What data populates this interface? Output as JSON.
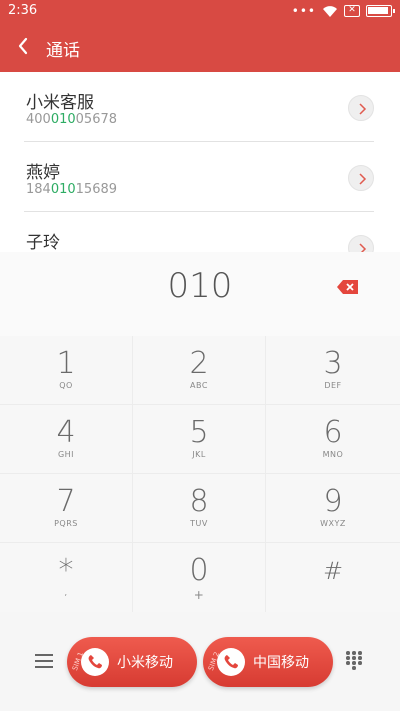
{
  "status_bar": {
    "time": "2:36",
    "dots": "•••"
  },
  "header": {
    "title": "通话"
  },
  "contacts": [
    {
      "name": "小米客服",
      "number_pre": "400",
      "number_hl": "010",
      "number_post": "05678"
    },
    {
      "name": "燕婷",
      "number_pre": "184",
      "number_hl": "010",
      "number_post": "15689"
    },
    {
      "name": "子玲",
      "number_pre": "",
      "number_hl": "",
      "number_post": ""
    }
  ],
  "dialer": {
    "input_value": "010",
    "keys": [
      {
        "digit": "1",
        "letters": "QO"
      },
      {
        "digit": "2",
        "letters": "ABC"
      },
      {
        "digit": "3",
        "letters": "DEF"
      },
      {
        "digit": "4",
        "letters": "GHI"
      },
      {
        "digit": "5",
        "letters": "JKL"
      },
      {
        "digit": "6",
        "letters": "MNO"
      },
      {
        "digit": "7",
        "letters": "PQRS"
      },
      {
        "digit": "8",
        "letters": "TUV"
      },
      {
        "digit": "9",
        "letters": "WXYZ"
      },
      {
        "digit": "*",
        "letters": ","
      },
      {
        "digit": "0",
        "letters": "+"
      },
      {
        "digit": "#",
        "letters": ""
      }
    ]
  },
  "call_buttons": {
    "sim1": {
      "tag": "SIM 1",
      "label": "小米移动"
    },
    "sim2": {
      "tag": "SIM 2",
      "label": "中国移动"
    }
  },
  "colors": {
    "header": "#d84a43",
    "accent": "#2dac63",
    "call": "#e4463d"
  }
}
